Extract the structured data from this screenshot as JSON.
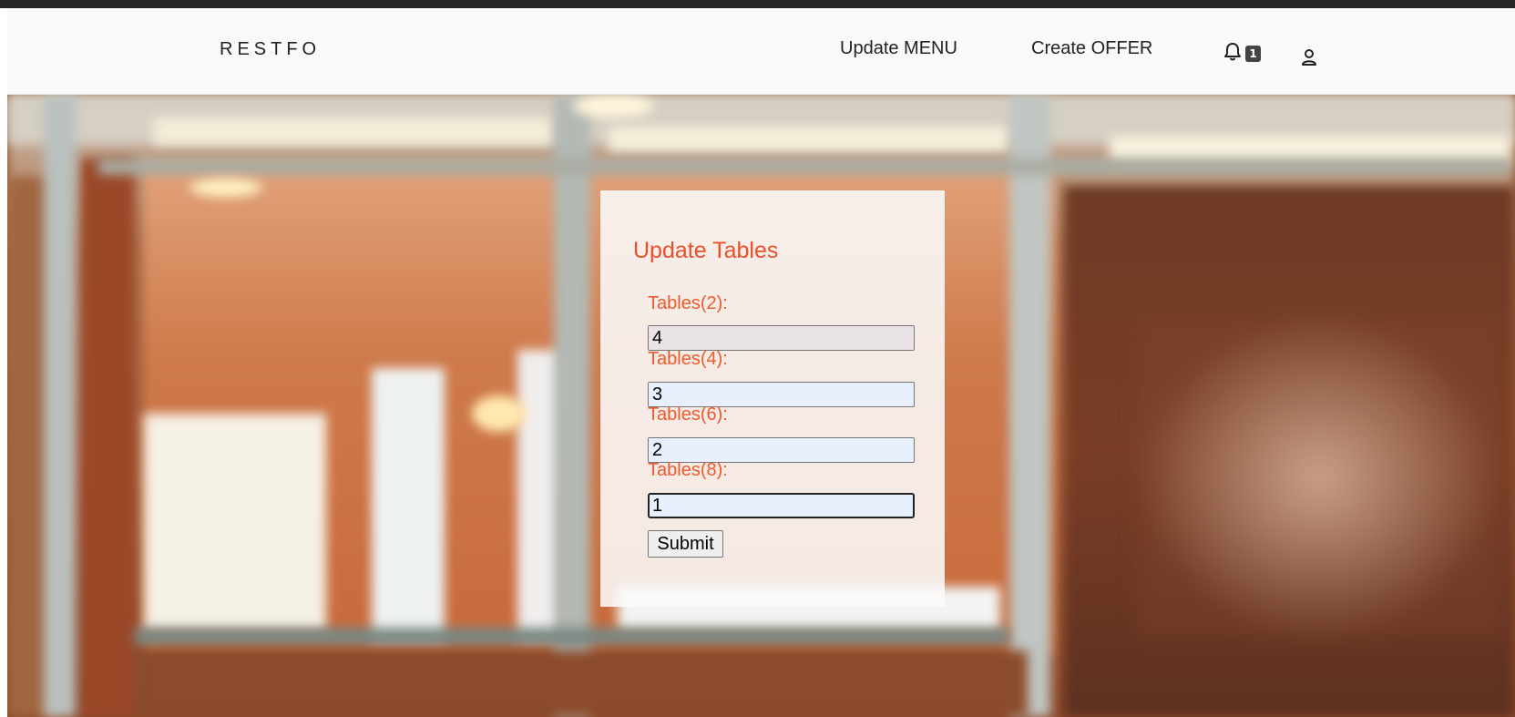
{
  "navbar": {
    "brand": "RESTFO",
    "links": {
      "update_menu": "Update MENU",
      "create_offer": "Create OFFER"
    },
    "notifications": {
      "icon": "bell-icon",
      "count": "1"
    },
    "account": {
      "icon": "user-icon"
    }
  },
  "form": {
    "title": "Update Tables",
    "fields": [
      {
        "label": "Tables(2):",
        "value": "4"
      },
      {
        "label": "Tables(4):",
        "value": "3"
      },
      {
        "label": "Tables(6):",
        "value": "2"
      },
      {
        "label": "Tables(8):",
        "value": "1"
      }
    ],
    "submit_label": "Submit"
  },
  "colors": {
    "accent": "#ee4e2a",
    "navbar_bg": "#f8f9fa",
    "input_bg": "#e8f0fe"
  }
}
